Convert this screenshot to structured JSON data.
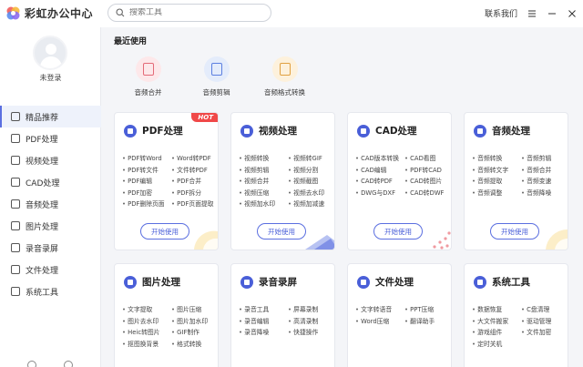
{
  "app": {
    "title": "彩虹办公中心"
  },
  "search": {
    "placeholder": "搜索工具"
  },
  "header": {
    "contact": "联系我们"
  },
  "user": {
    "status": "未登录"
  },
  "sidebar": {
    "items": [
      {
        "label": "精品推荐",
        "icon": "thumb-up-icon"
      },
      {
        "label": "PDF处理",
        "icon": "pdf-icon"
      },
      {
        "label": "视频处理",
        "icon": "video-icon"
      },
      {
        "label": "CAD处理",
        "icon": "cad-icon"
      },
      {
        "label": "音频处理",
        "icon": "music-icon"
      },
      {
        "label": "图片处理",
        "icon": "image-icon"
      },
      {
        "label": "录音录屏",
        "icon": "record-icon"
      },
      {
        "label": "文件处理",
        "icon": "folder-icon"
      },
      {
        "label": "系统工具",
        "icon": "toolbox-icon"
      }
    ]
  },
  "recent": {
    "title": "最近使用",
    "items": [
      {
        "label": "音频合并",
        "bg": "#fde8ea",
        "fg": "#e46a78"
      },
      {
        "label": "音频剪辑",
        "bg": "#e4ecfb",
        "fg": "#5b7fe0"
      },
      {
        "label": "音频格式转换",
        "bg": "#fdf1dc",
        "fg": "#e0a040"
      }
    ]
  },
  "cards": [
    {
      "title": "PDF处理",
      "hot": "HOT",
      "features": [
        "PDF转Word",
        "Word转PDF",
        "PDF转文件",
        "文件转PDF",
        "PDF编辑",
        "PDF合并",
        "PDF加密",
        "PDF拆分",
        "PDF删除页面",
        "PDF页面提取"
      ],
      "button": "开始使用"
    },
    {
      "title": "视频处理",
      "features": [
        "视频转换",
        "视频转GIF",
        "视频剪辑",
        "视频分割",
        "视频合并",
        "视频截图",
        "视频压缩",
        "视频去水印",
        "视频加水印",
        "视频加减速"
      ],
      "button": "开始使用"
    },
    {
      "title": "CAD处理",
      "features": [
        "CAD版本转换",
        "CAD看图",
        "CAD编辑",
        "PDF转CAD",
        "CAD转PDF",
        "CAD转图片",
        "DWG与DXF",
        "CAD转DWF"
      ],
      "button": "开始使用"
    },
    {
      "title": "音频处理",
      "features": [
        "音频转换",
        "音频剪辑",
        "音频转文字",
        "音频合并",
        "音频提取",
        "音频变速",
        "音频调整",
        "音频降噪"
      ],
      "button": "开始使用"
    },
    {
      "title": "图片处理",
      "features": [
        "文字提取",
        "图片压缩",
        "图片去水印",
        "图片加水印",
        "Heic转图片",
        "GIF制作",
        "抠图换背景",
        "格式转换"
      ]
    },
    {
      "title": "录音录屏",
      "features": [
        "录音工具",
        "屏幕录制",
        "录音编辑",
        "高清录制",
        "录音降噪",
        "快捷操作"
      ]
    },
    {
      "title": "文件处理",
      "features": [
        "文字转语音",
        "PPT压缩",
        "Word压缩",
        "翻译助手"
      ]
    },
    {
      "title": "系统工具",
      "features": [
        "数据恢复",
        "C盘清理",
        "大文件搬家",
        "驱动管理",
        "游戏组件",
        "文件加密",
        "定时关机"
      ]
    }
  ],
  "colors": {
    "accent": "#4a5fd8",
    "hot": "#f04848"
  }
}
